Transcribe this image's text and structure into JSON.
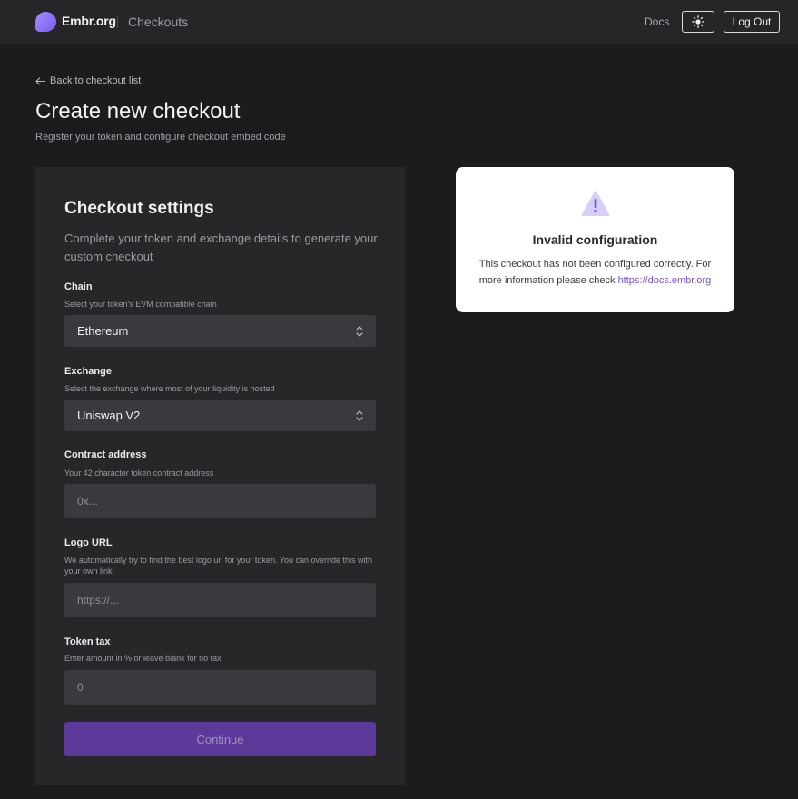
{
  "header": {
    "brand": "Embr.org",
    "section": "Checkouts",
    "docs_label": "Docs",
    "theme_icon": "sun-icon",
    "logout_label": "Log Out"
  },
  "page": {
    "back_label": "Back to checkout list",
    "title": "Create new checkout",
    "subtitle": "Register your token and configure checkout embed code"
  },
  "settings": {
    "title": "Checkout settings",
    "description": "Complete your token and exchange details to generate your custom checkout",
    "chain": {
      "label": "Chain",
      "help": "Select your token's EVM compatible chain",
      "value": "Ethereum"
    },
    "exchange": {
      "label": "Exchange",
      "help": "Select the exchange where most of your liquidity is hosted",
      "value": "Uniswap V2"
    },
    "contract": {
      "label": "Contract address",
      "help": "Your 42 character token contract address",
      "placeholder": "0x..."
    },
    "logo": {
      "label": "Logo URL",
      "help": "We automatically try to find the best logo url for your token. You can override this with your own link.",
      "placeholder": "https://..."
    },
    "tax": {
      "label": "Token tax",
      "help": "Enter amount in % or leave blank for no tax",
      "placeholder": "0"
    },
    "continue_label": "Continue"
  },
  "notice": {
    "icon": "warning-icon",
    "title": "Invalid configuration",
    "text": "This checkout has not been configured correctly. For more information please check ",
    "link": "https://docs.embr.org"
  },
  "colors": {
    "background": "#1c1c1e",
    "panel": "#27272a",
    "accent": "#5b3a99",
    "link": "#6f56d6"
  }
}
